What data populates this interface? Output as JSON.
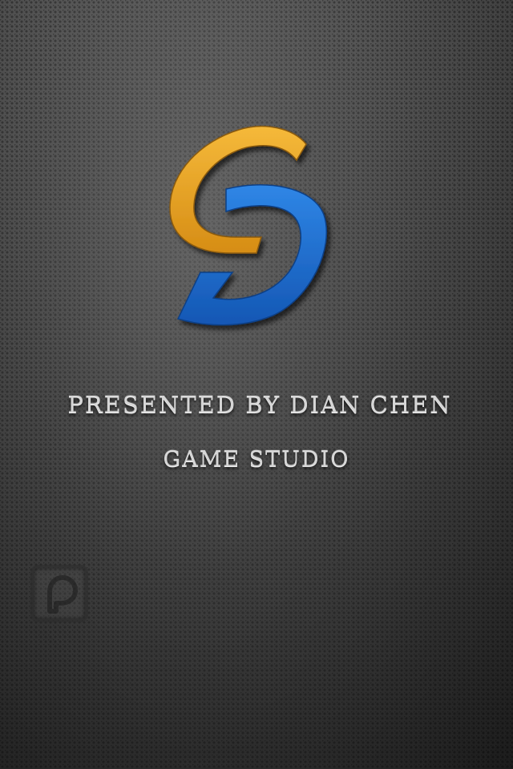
{
  "screen": "splash",
  "logo": {
    "name": "studio-logo",
    "colors": {
      "top_arc": "#e8a524",
      "bottom_shape": "#1f6fd1"
    }
  },
  "credits": {
    "presenter": "Presented by Dian Chen",
    "studio": "Game Studio"
  },
  "corner_icon": {
    "name": "tap-icon"
  }
}
